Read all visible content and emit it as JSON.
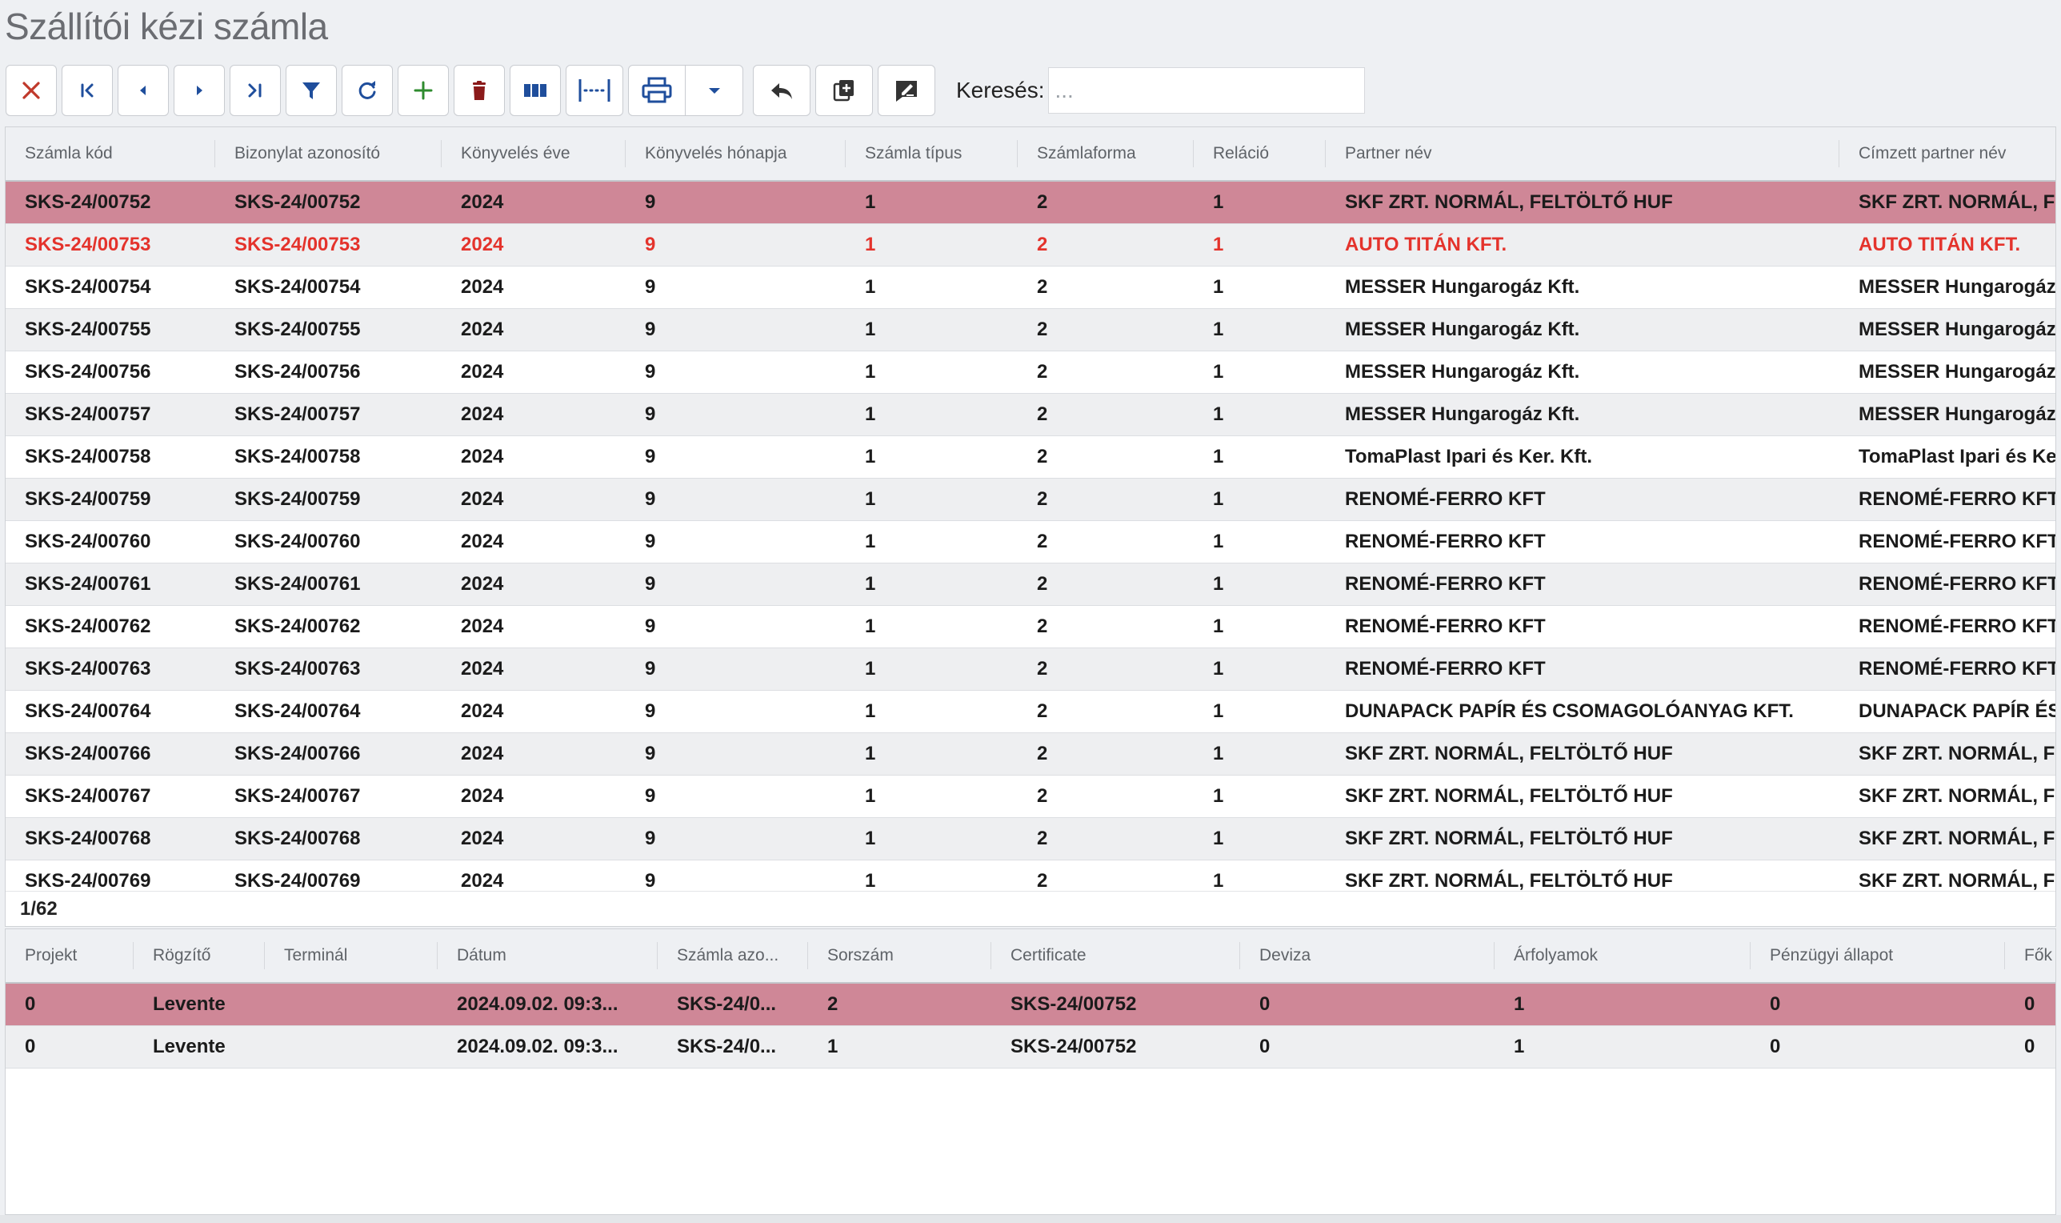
{
  "page": {
    "title": "Szállítói kézi számla"
  },
  "toolbar": {
    "buttons": [
      {
        "name": "close-button",
        "icon": "close-icon",
        "color": "#c0392b"
      },
      {
        "name": "first-record-button",
        "icon": "first-icon",
        "color": "#1f4e9c"
      },
      {
        "name": "prev-record-button",
        "icon": "prev-icon",
        "color": "#1f4e9c"
      },
      {
        "name": "next-record-button",
        "icon": "next-icon",
        "color": "#1f4e9c"
      },
      {
        "name": "last-record-button",
        "icon": "last-icon",
        "color": "#1f4e9c"
      },
      {
        "name": "filter-button",
        "icon": "filter-icon",
        "color": "#1f4e9c"
      },
      {
        "name": "refresh-button",
        "icon": "refresh-icon",
        "color": "#1f4e9c"
      },
      {
        "name": "add-button",
        "icon": "plus-icon",
        "color": "#2e8b2e"
      },
      {
        "name": "delete-button",
        "icon": "trash-icon",
        "color": "#8b1a1a"
      },
      {
        "name": "columns-button",
        "icon": "columns-icon",
        "color": "#1f4e9c"
      },
      {
        "name": "fit-columns-button",
        "icon": "fit-width-icon",
        "color": "#1f4e9c"
      },
      {
        "name": "print-button",
        "icon": "printer-icon",
        "color": "#1f4e9c"
      },
      {
        "name": "print-menu-button",
        "icon": "caret-down-icon",
        "color": "#1f4e9c"
      },
      {
        "name": "undo-button",
        "icon": "reply-icon",
        "color": "#333333"
      },
      {
        "name": "copy-add-button",
        "icon": "copy-plus-icon",
        "color": "#333333"
      },
      {
        "name": "edit-note-button",
        "icon": "edit-note-icon",
        "color": "#333333"
      }
    ],
    "search_label": "Keresés:",
    "search_placeholder": "..."
  },
  "main_table": {
    "columns": [
      "Számla kód",
      "Bizonylat azonosító",
      "Könyvelés éve",
      "Könyvelés hónapja",
      "Számla típus",
      "Számlaforma",
      "Reláció",
      "Partner név",
      "Címzett partner név"
    ],
    "rows": [
      [
        "SKS-24/00752",
        "SKS-24/00752",
        "2024",
        "9",
        "1",
        "2",
        "1",
        "SKF ZRT. NORMÁL, FELTÖLTŐ HUF",
        "SKF ZRT. NORMÁL, F"
      ],
      [
        "SKS-24/00753",
        "SKS-24/00753",
        "2024",
        "9",
        "1",
        "2",
        "1",
        "AUTO TITÁN KFT.",
        "AUTO TITÁN KFT."
      ],
      [
        "SKS-24/00754",
        "SKS-24/00754",
        "2024",
        "9",
        "1",
        "2",
        "1",
        "MESSER Hungarogáz Kft.",
        "MESSER Hungarogáz"
      ],
      [
        "SKS-24/00755",
        "SKS-24/00755",
        "2024",
        "9",
        "1",
        "2",
        "1",
        "MESSER Hungarogáz Kft.",
        "MESSER Hungarogáz"
      ],
      [
        "SKS-24/00756",
        "SKS-24/00756",
        "2024",
        "9",
        "1",
        "2",
        "1",
        "MESSER Hungarogáz Kft.",
        "MESSER Hungarogáz"
      ],
      [
        "SKS-24/00757",
        "SKS-24/00757",
        "2024",
        "9",
        "1",
        "2",
        "1",
        "MESSER Hungarogáz Kft.",
        "MESSER Hungarogáz"
      ],
      [
        "SKS-24/00758",
        "SKS-24/00758",
        "2024",
        "9",
        "1",
        "2",
        "1",
        "TomaPlast Ipari és Ker. Kft.",
        "TomaPlast Ipari és Ke"
      ],
      [
        "SKS-24/00759",
        "SKS-24/00759",
        "2024",
        "9",
        "1",
        "2",
        "1",
        "RENOMÉ-FERRO KFT",
        "RENOMÉ-FERRO KFT"
      ],
      [
        "SKS-24/00760",
        "SKS-24/00760",
        "2024",
        "9",
        "1",
        "2",
        "1",
        "RENOMÉ-FERRO KFT",
        "RENOMÉ-FERRO KFT"
      ],
      [
        "SKS-24/00761",
        "SKS-24/00761",
        "2024",
        "9",
        "1",
        "2",
        "1",
        "RENOMÉ-FERRO KFT",
        "RENOMÉ-FERRO KFT"
      ],
      [
        "SKS-24/00762",
        "SKS-24/00762",
        "2024",
        "9",
        "1",
        "2",
        "1",
        "RENOMÉ-FERRO KFT",
        "RENOMÉ-FERRO KFT"
      ],
      [
        "SKS-24/00763",
        "SKS-24/00763",
        "2024",
        "9",
        "1",
        "2",
        "1",
        "RENOMÉ-FERRO KFT",
        "RENOMÉ-FERRO KFT"
      ],
      [
        "SKS-24/00764",
        "SKS-24/00764",
        "2024",
        "9",
        "1",
        "2",
        "1",
        "DUNAPACK PAPÍR ÉS CSOMAGOLÓANYAG KFT.",
        "DUNAPACK PAPÍR ÉS"
      ],
      [
        "SKS-24/00766",
        "SKS-24/00766",
        "2024",
        "9",
        "1",
        "2",
        "1",
        "SKF ZRT. NORMÁL, FELTÖLTŐ HUF",
        "SKF ZRT. NORMÁL, F"
      ],
      [
        "SKS-24/00767",
        "SKS-24/00767",
        "2024",
        "9",
        "1",
        "2",
        "1",
        "SKF ZRT. NORMÁL, FELTÖLTŐ HUF",
        "SKF ZRT. NORMÁL, F"
      ],
      [
        "SKS-24/00768",
        "SKS-24/00768",
        "2024",
        "9",
        "1",
        "2",
        "1",
        "SKF ZRT. NORMÁL, FELTÖLTŐ HUF",
        "SKF ZRT. NORMÁL, F"
      ],
      [
        "SKS-24/00769",
        "SKS-24/00769",
        "2024",
        "9",
        "1",
        "2",
        "1",
        "SKF ZRT. NORMÁL, FELTÖLTŐ HUF",
        "SKF ZRT. NORMÁL, F"
      ]
    ],
    "selected_row": 0,
    "highlight_row": 1,
    "pager": "1/62",
    "colors": {
      "selected_bg": "#cf8797",
      "highlight_text": "#e4332c"
    }
  },
  "detail_table": {
    "columns": [
      "Projekt",
      "Rögzítő",
      "Terminál",
      "Dátum",
      "Számla azo...",
      "Sorszám",
      "Certificate",
      "Deviza",
      "Árfolyamok",
      "Pénzügyi állapot",
      "Fők"
    ],
    "rows": [
      [
        "0",
        "Levente",
        "",
        "2024.09.02. 09:3...",
        "SKS-24/0...",
        "2",
        "SKS-24/00752",
        "0",
        "1",
        "0",
        "0"
      ],
      [
        "0",
        "Levente",
        "",
        "2024.09.02. 09:3...",
        "SKS-24/0...",
        "1",
        "SKS-24/00752",
        "0",
        "1",
        "0",
        "0"
      ]
    ],
    "selected_row": 0
  }
}
